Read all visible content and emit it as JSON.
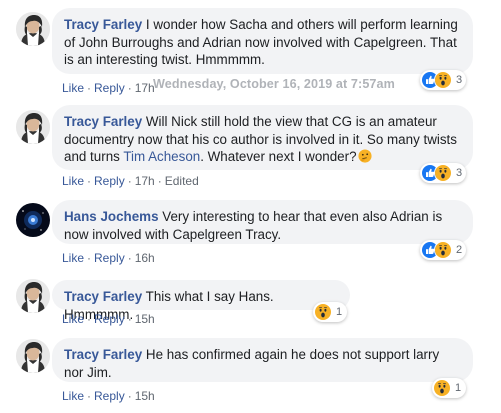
{
  "comments": [
    {
      "author": "Tracy Farley",
      "text": " I wonder how Sacha and others will perform learning of John Burroughs and Adrian now involved with Capelgreen. That is an interesting twist. Hmmmmm.",
      "actions": {
        "like": "Like",
        "reply": "Reply",
        "time": "17h"
      },
      "tooltip": "Wednesday, October 16, 2019 at 7:57am",
      "reactions": {
        "icons": [
          "like-icon",
          "wow-icon"
        ],
        "count": "3"
      }
    },
    {
      "author": "Tracy Farley",
      "text_before": " Will Nick still hold the view that CG is an amateur documentry now that his co author is involved in it. So many twists and turns ",
      "mention": "Tim Acheson",
      "text_after": ". Whatever next I wonder?",
      "emoji": "thinking-emoji",
      "actions": {
        "like": "Like",
        "reply": "Reply",
        "time": "17h",
        "edited": "Edited"
      },
      "reactions": {
        "icons": [
          "like-icon",
          "wow-icon"
        ],
        "count": "3"
      }
    },
    {
      "author": "Hans Jochems",
      "text": " Very interesting to hear that even also Adrian is now involved with Capelgreen Tracy.",
      "actions": {
        "like": "Like",
        "reply": "Reply",
        "time": "16h"
      },
      "reactions": {
        "icons": [
          "like-icon",
          "wow-icon"
        ],
        "count": "2"
      }
    },
    {
      "author": "Tracy Farley",
      "text": " This what I say Hans. Hmmmmm.",
      "actions": {
        "like": "Like",
        "reply": "Reply",
        "time": "15h"
      },
      "reactions": {
        "icons": [
          "wow-icon"
        ],
        "count": "1"
      }
    },
    {
      "author": "Tracy Farley",
      "text": " He has confirmed again he does not support larry nor Jim.",
      "actions": {
        "like": "Like",
        "reply": "Reply",
        "time": "15h"
      },
      "reactions": {
        "icons": [
          "wow-icon"
        ],
        "count": "1"
      }
    }
  ],
  "separator": "·",
  "colors": {
    "link": "#385898",
    "bubble": "#f2f3f5",
    "like": "#1877f2",
    "wow": "#f7b125"
  }
}
